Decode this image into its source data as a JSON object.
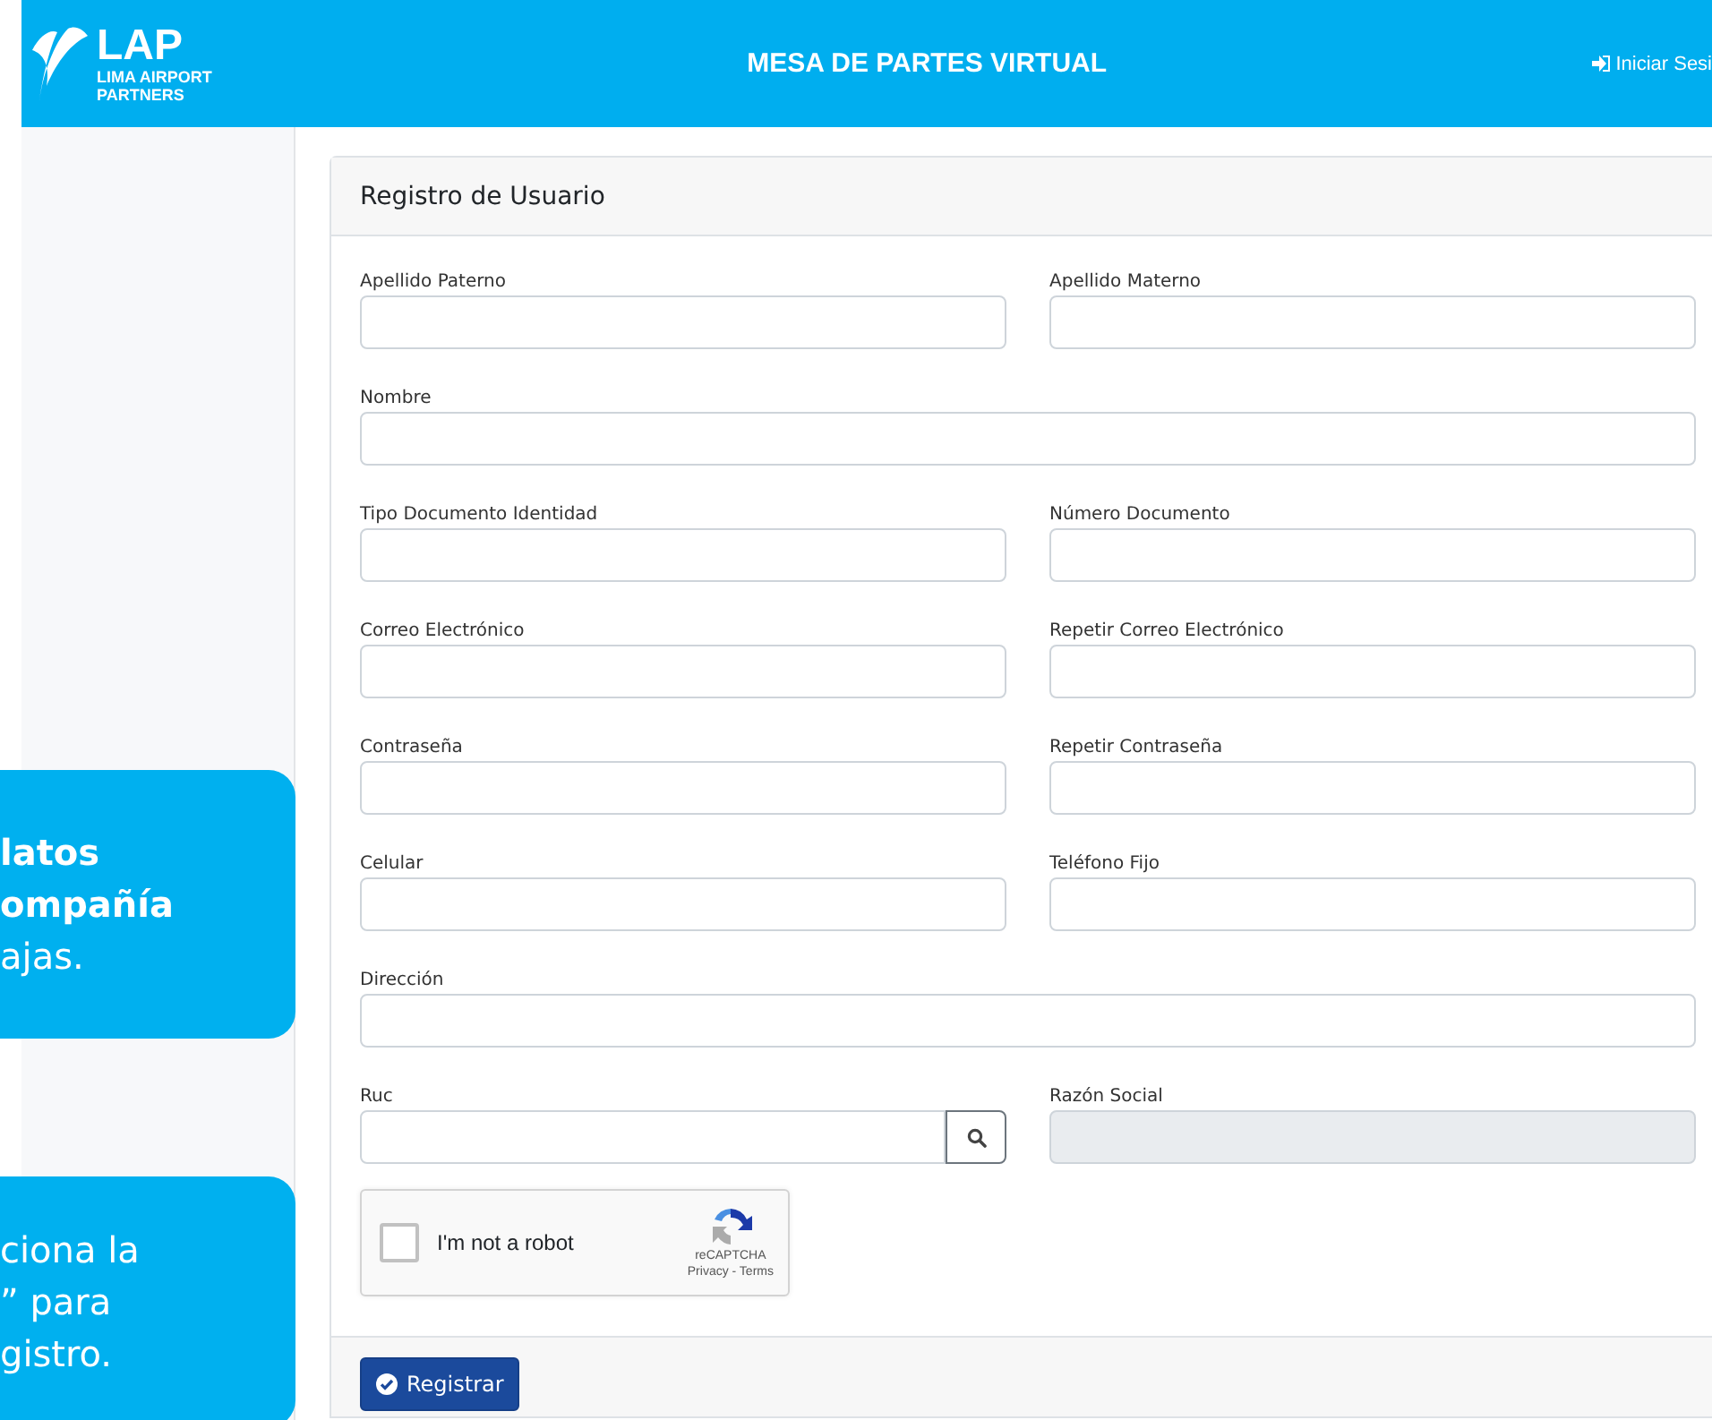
{
  "header": {
    "logo": {
      "name": "LAP",
      "line_1": "LIMA AIRPORT",
      "line_2": "PARTNERS"
    },
    "title": "MESA DE PARTES VIRTUAL",
    "login_link": "Iniciar Sesi"
  },
  "callouts": [
    {
      "lines": [
        {
          "text": "latos",
          "bold": true
        },
        {
          "text": "ompañía",
          "bold": true
        },
        {
          "text": "ajas.",
          "bold": false
        }
      ]
    },
    {
      "lines": [
        {
          "text": "ciona la",
          "bold": false
        },
        {
          "text": "” para",
          "bold": false
        },
        {
          "text": "gistro.",
          "bold": false
        }
      ]
    }
  ],
  "form": {
    "title": "Registro de Usuario",
    "rows": [
      [
        {
          "label": "Apellido Paterno",
          "kind": "text",
          "disabled": false
        },
        {
          "label": "Apellido Materno",
          "kind": "text",
          "disabled": false
        }
      ],
      [
        {
          "label": "Nombre",
          "kind": "text",
          "disabled": false
        }
      ],
      [
        {
          "label": "Tipo Documento Identidad",
          "kind": "text",
          "disabled": false
        },
        {
          "label": "Número Documento",
          "kind": "text",
          "disabled": false
        }
      ],
      [
        {
          "label": "Correo Electrónico",
          "kind": "text",
          "disabled": false
        },
        {
          "label": "Repetir Correo Electrónico",
          "kind": "text",
          "disabled": false
        }
      ],
      [
        {
          "label": "Contraseña",
          "kind": "text",
          "disabled": false
        },
        {
          "label": "Repetir Contraseña",
          "kind": "text",
          "disabled": false
        }
      ],
      [
        {
          "label": "Celular",
          "kind": "text",
          "disabled": false
        },
        {
          "label": "Teléfono Fijo",
          "kind": "text",
          "disabled": false
        }
      ],
      [
        {
          "label": "Dirección",
          "kind": "text",
          "disabled": false
        }
      ],
      [
        {
          "label": "Ruc",
          "kind": "search",
          "disabled": false
        },
        {
          "label": "Razón Social",
          "kind": "text",
          "disabled": true
        }
      ]
    ],
    "captcha": {
      "label": "I'm not a robot",
      "checked": false,
      "brand": "reCAPTCHA",
      "links": "Privacy - Terms"
    },
    "submit": "Registrar"
  }
}
